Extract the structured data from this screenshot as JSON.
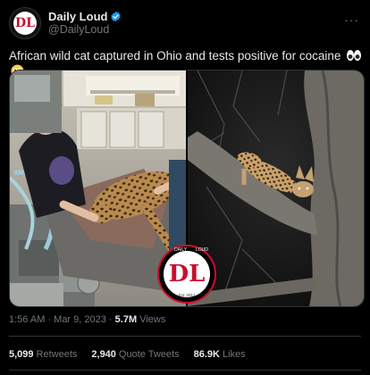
{
  "author": {
    "display_name": "Daily Loud",
    "handle": "@DailyLoud",
    "avatar_text": "DL",
    "verified": true
  },
  "tweet": {
    "text": "African wild cat captured in Ohio and tests positive for cocaine",
    "emoji": [
      "eyes",
      "flushed-face"
    ]
  },
  "media": {
    "watermark": {
      "top_text": "DAILY",
      "right_text": "LOUD",
      "mark": "DL",
      "bottom_text": "Est. 2012"
    }
  },
  "meta": {
    "time": "1:56 AM",
    "sep1": "·",
    "date": "Mar 9, 2023",
    "sep2": "·",
    "views_count": "5.7M",
    "views_label": "Views"
  },
  "stats": {
    "retweets_count": "5,099",
    "retweets_label": "Retweets",
    "quotes_count": "2,940",
    "quotes_label": "Quote Tweets",
    "likes_count": "86.9K",
    "likes_label": "Likes"
  },
  "colors": {
    "background": "#000000",
    "text": "#e7e9ea",
    "muted": "#71767b",
    "verified": "#1d9bf0",
    "brand_red": "#c8102e"
  }
}
